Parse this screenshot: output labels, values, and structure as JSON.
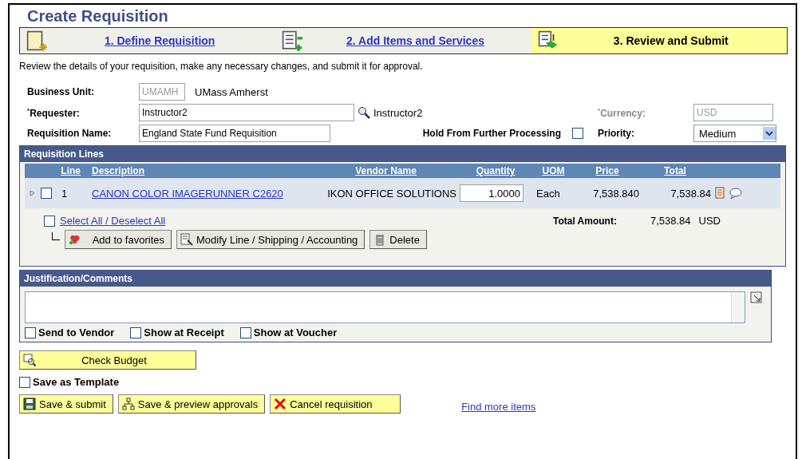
{
  "title": "Create Requisition",
  "steps": [
    {
      "label": "1. Define Requisition",
      "selected": false
    },
    {
      "label": "2. Add Items and Services",
      "selected": false
    },
    {
      "label": "3. Review and Submit",
      "selected": true
    }
  ],
  "instructions": "Review the details of your requisition, make any necessary changes, and submit it for approval.",
  "business_unit": {
    "label": "Business Unit:",
    "value": "UMAMH",
    "disabled": true,
    "description": "UMass Amherst"
  },
  "requester": {
    "required_mark": "*",
    "label": "Requester:",
    "value": "Instructor2",
    "description": "Instructor2"
  },
  "currency": {
    "required_mark": "*",
    "label": "Currency:",
    "value": "USD",
    "disabled": true
  },
  "requisition_name": {
    "label": "Requisition Name:",
    "value": "England State Fund Requisition"
  },
  "hold": {
    "label": "Hold From Further Processing",
    "checked": false
  },
  "priority": {
    "label": "Priority:",
    "value": "Medium"
  },
  "lines": {
    "title": "Requisition Lines",
    "columns": [
      "Line",
      "Description",
      "Vendor Name",
      "Quantity",
      "UOM",
      "Price",
      "Total"
    ],
    "rows": [
      {
        "checked": false,
        "line": "1",
        "description": "CANON COLOR IMAGERUNNER C2620",
        "vendor": "IKON OFFICE SOLUTIONS",
        "quantity": "1.0000",
        "uom": "Each",
        "price": "7,538.840",
        "total": "7,538.84"
      }
    ],
    "select_all": "Select All / Deselect All",
    "select_all_checked": false,
    "total_label": "Total Amount:",
    "total_amount": "7,538.84",
    "total_currency": "USD",
    "buttons": [
      {
        "kind": "favorite",
        "label": "Add to favorites"
      },
      {
        "kind": "modify",
        "label": "Modify Line / Shipping / Accounting"
      },
      {
        "kind": "delete",
        "label": "Delete"
      }
    ]
  },
  "justification": {
    "title": "Justification/Comments",
    "options": [
      {
        "label": "Send to Vendor",
        "checked": false
      },
      {
        "label": "Show at Receipt",
        "checked": false
      },
      {
        "label": "Show at Voucher",
        "checked": false
      }
    ]
  },
  "check_budget": "Check Budget",
  "save_as_template": {
    "label": "Save as Template",
    "checked": false
  },
  "actions": [
    {
      "kind": "save",
      "label": "Save & submit"
    },
    {
      "kind": "approvals",
      "label": "Save & preview approvals"
    },
    {
      "kind": "cancel",
      "label": "Cancel requisition"
    }
  ],
  "find_more": "Find more items"
}
